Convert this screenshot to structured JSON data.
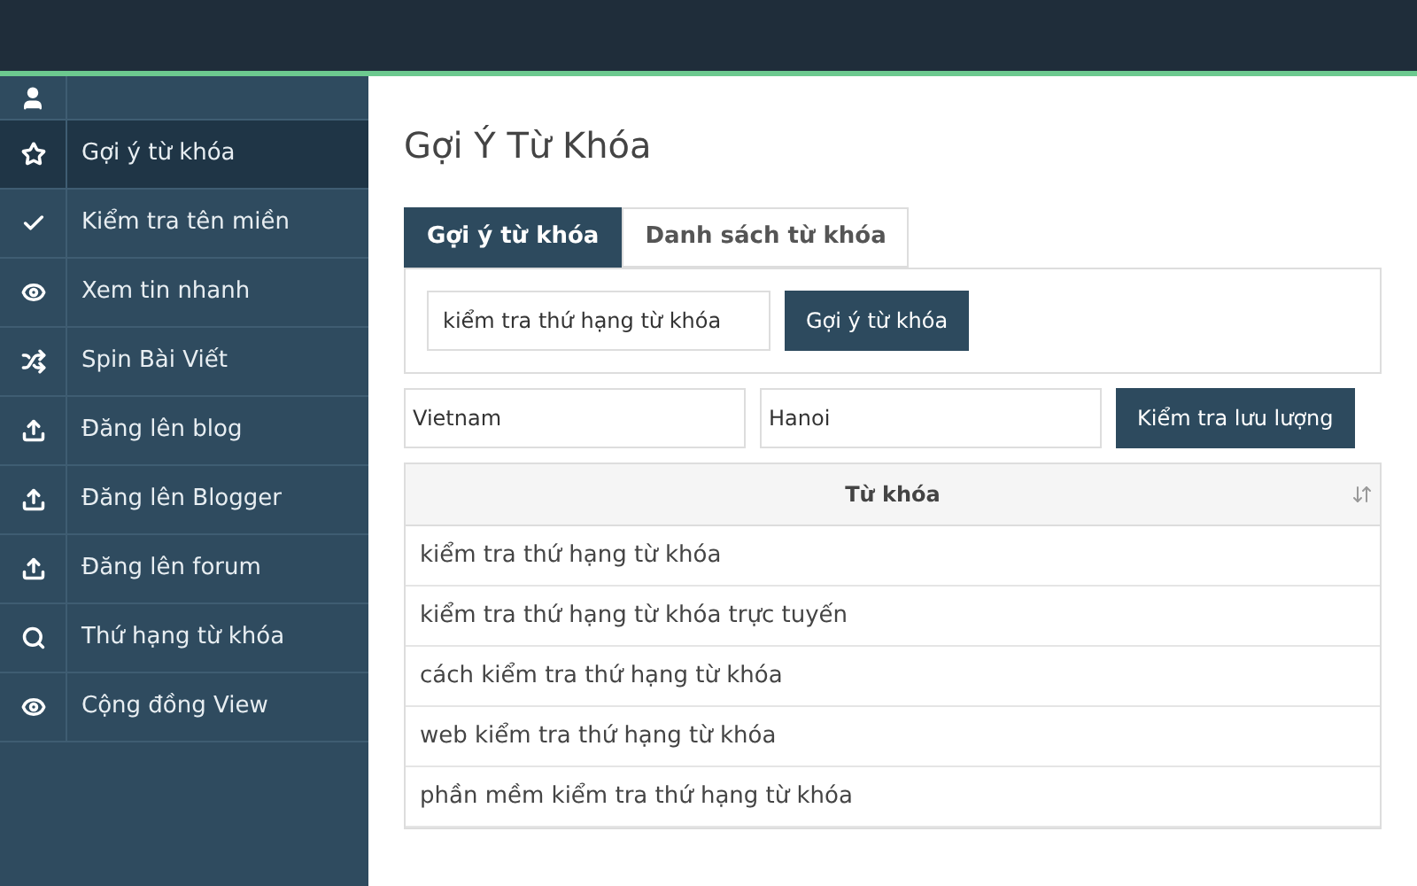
{
  "sidebar": {
    "items": [
      {
        "label": "Gợi ý từ khóa",
        "selected": true
      },
      {
        "label": "Kiểm tra tên miền",
        "selected": false
      },
      {
        "label": "Xem tin nhanh",
        "selected": false
      },
      {
        "label": "Spin Bài Viết",
        "selected": false
      },
      {
        "label": "Đăng lên blog",
        "selected": false
      },
      {
        "label": "Đăng lên Blogger",
        "selected": false
      },
      {
        "label": "Đăng lên forum",
        "selected": false
      },
      {
        "label": "Thứ hạng từ khóa",
        "selected": false
      },
      {
        "label": "Cộng đồng View",
        "selected": false
      }
    ]
  },
  "page_title": "Gợi Ý Từ Khóa",
  "tabs": [
    {
      "label": "Gợi ý từ khóa",
      "selected": true
    },
    {
      "label": "Danh sách từ khóa",
      "selected": false
    }
  ],
  "keyword_form": {
    "value": "kiểm tra thứ hạng từ khóa",
    "button": "Gợi ý từ khóa"
  },
  "traffic_form": {
    "country": "Vietnam",
    "city": "Hanoi",
    "button": "Kiểm tra lưu lượng"
  },
  "table": {
    "columns": [
      "Từ khóa"
    ],
    "rows": [
      "kiểm tra thứ hạng từ khóa",
      "kiểm tra thứ hạng từ khóa trực tuyến",
      "cách kiểm tra thứ hạng từ khóa",
      "web kiểm tra thứ hạng từ khóa",
      "phần mềm kiểm tra thứ hạng từ khóa"
    ]
  }
}
